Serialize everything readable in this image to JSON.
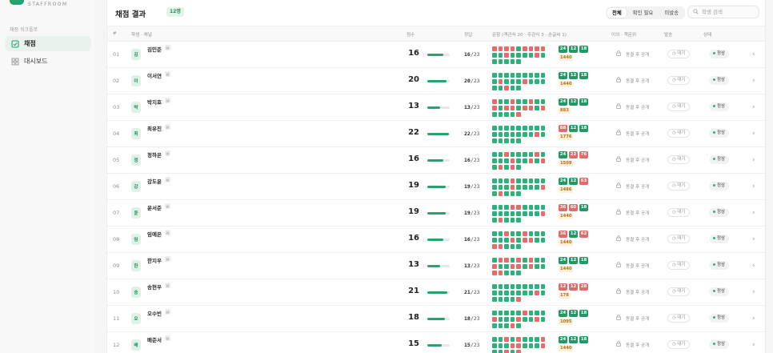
{
  "brand": {
    "subtitle": "STAFFROOM"
  },
  "sidebar": {
    "section_title": "채점 워크플로",
    "items": [
      {
        "label": "채점",
        "icon": "checkbox-icon"
      },
      {
        "label": "대시보드",
        "icon": "grid-icon"
      }
    ]
  },
  "header": {
    "title": "채점 결과",
    "count": "12명",
    "filters": [
      "전체",
      "확인 필요",
      "미발송"
    ],
    "active_filter": "전체",
    "search_placeholder": "학생 검색"
  },
  "columns": {
    "no": "#",
    "student": "학생 · 채널",
    "score": "점수",
    "correct": "정답",
    "questions": "문항 (객관식 20 · 주관식 3 · 손글씨 1)",
    "ai": "이의 · 책문위",
    "send": "발송",
    "status": "상태"
  },
  "total_questions": 23,
  "colors": {
    "accent": "#26a36f",
    "correct": "#2bb37a",
    "wrong": "#e86a6a"
  },
  "rows": [
    {
      "no": "01",
      "initial": "김",
      "name": "김민준",
      "score": "16",
      "correct": "16",
      "total": "/23",
      "wrong": [
        0,
        1,
        2,
        3,
        5,
        6,
        7,
        8,
        11,
        16
      ],
      "pills": [
        [
          "24",
          "ok"
        ],
        [
          "12",
          "ok"
        ],
        [
          "18",
          "ok"
        ]
      ],
      "chars": "1440",
      "lock_text": "동결 후 공개",
      "wait": "대기",
      "status": "정상"
    },
    {
      "no": "02",
      "initial": "이",
      "name": "이서연",
      "score": "20",
      "correct": "20",
      "total": "/23",
      "wrong": [
        10,
        14,
        20
      ],
      "pills": [
        [
          "24",
          "ok"
        ],
        [
          "12",
          "ok"
        ],
        [
          "18",
          "ok"
        ]
      ],
      "chars": "1440",
      "lock_text": "동결 후 공개",
      "wait": "대기",
      "status": "정상"
    },
    {
      "no": "03",
      "initial": "박",
      "name": "박지호",
      "score": "13",
      "correct": "13",
      "total": "/23",
      "wrong": [
        0,
        3,
        6,
        9,
        11,
        12,
        14,
        15,
        17,
        22
      ],
      "pills": [
        [
          "24",
          "ok"
        ],
        [
          "12",
          "ok"
        ],
        [
          "18",
          "ok"
        ]
      ],
      "chars": "883",
      "lock_text": "동결 후 공개",
      "wait": "대기",
      "status": "정상"
    },
    {
      "no": "04",
      "initial": "최",
      "name": "최유진",
      "score": "22",
      "correct": "22",
      "total": "/23",
      "wrong": [
        16
      ],
      "pills": [
        [
          "88",
          "bad"
        ],
        [
          "12",
          "ok"
        ],
        [
          "18",
          "ok"
        ]
      ],
      "chars": "1776",
      "lock_text": "동결 후 공개",
      "wait": "대기",
      "status": "정상"
    },
    {
      "no": "05",
      "initial": "정",
      "name": "정하은",
      "score": "16",
      "correct": "16",
      "total": "/23",
      "wrong": [
        2,
        7,
        12,
        15,
        17,
        19,
        21
      ],
      "pills": [
        [
          "24",
          "ok"
        ],
        [
          "22",
          "bad"
        ],
        [
          "76",
          "bad"
        ]
      ],
      "chars": "1509",
      "lock_text": "동결 후 공개",
      "wait": "대기",
      "status": "정상"
    },
    {
      "no": "06",
      "initial": "강",
      "name": "강도윤",
      "score": "19",
      "correct": "19",
      "total": "/23",
      "wrong": [
        3,
        12,
        17,
        19
      ],
      "pills": [
        [
          "24",
          "ok"
        ],
        [
          "12",
          "ok"
        ],
        [
          "63",
          "bad"
        ]
      ],
      "chars": "1486",
      "lock_text": "동결 후 공개",
      "wait": "대기",
      "status": "정상"
    },
    {
      "no": "07",
      "initial": "윤",
      "name": "윤서준",
      "score": "19",
      "correct": "19",
      "total": "/23",
      "wrong": [
        3,
        4,
        17,
        19
      ],
      "pills": [
        [
          "36",
          "bad"
        ],
        [
          "60",
          "bad"
        ],
        [
          "18",
          "ok"
        ]
      ],
      "chars": "1440",
      "lock_text": "동결 후 공개",
      "wait": "대기",
      "status": "정상"
    },
    {
      "no": "08",
      "initial": "임",
      "name": "임예은",
      "score": "16",
      "correct": "16",
      "total": "/23",
      "wrong": [
        2,
        5,
        12,
        14,
        15,
        18,
        19
      ],
      "pills": [
        [
          "36",
          "bad"
        ],
        [
          "12",
          "ok"
        ],
        [
          "62",
          "bad"
        ]
      ],
      "chars": "1440",
      "lock_text": "동결 후 공개",
      "wait": "대기",
      "status": "정상"
    },
    {
      "no": "09",
      "initial": "한",
      "name": "한지우",
      "score": "13",
      "correct": "13",
      "total": "/23",
      "wrong": [
        1,
        2,
        4,
        6,
        9,
        12,
        13,
        15,
        18,
        19
      ],
      "pills": [
        [
          "24",
          "ok"
        ],
        [
          "12",
          "ok"
        ],
        [
          "18",
          "ok"
        ]
      ],
      "chars": "1440",
      "lock_text": "동결 후 공개",
      "wait": "대기",
      "status": "정상"
    },
    {
      "no": "10",
      "initial": "송",
      "name": "송현우",
      "score": "21",
      "correct": "21",
      "total": "/23",
      "wrong": [
        16,
        22
      ],
      "pills": [
        [
          "12",
          "bad"
        ],
        [
          "12",
          "bad"
        ],
        [
          "28",
          "bad"
        ]
      ],
      "chars": "178",
      "lock_text": "동결 후 공개",
      "wait": "대기",
      "status": "정상"
    },
    {
      "no": "11",
      "initial": "오",
      "name": "오수빈",
      "score": "18",
      "correct": "18",
      "total": "/23",
      "wrong": [
        5,
        9,
        13,
        16,
        21
      ],
      "pills": [
        [
          "24",
          "ok"
        ],
        [
          "12",
          "ok"
        ],
        [
          "18",
          "ok"
        ]
      ],
      "chars": "1095",
      "lock_text": "동결 후 공개",
      "wait": "대기",
      "status": "정상"
    },
    {
      "no": "12",
      "initial": "배",
      "name": "배준서",
      "score": "15",
      "correct": "15",
      "total": "/23",
      "wrong": [
        2,
        4,
        8,
        12,
        13,
        17,
        20,
        22
      ],
      "pills": [
        [
          "24",
          "ok"
        ],
        [
          "12",
          "ok"
        ],
        [
          "18",
          "ok"
        ]
      ],
      "chars": "1440",
      "lock_text": "동결 후 공개",
      "wait": "대기",
      "status": "정상"
    }
  ]
}
